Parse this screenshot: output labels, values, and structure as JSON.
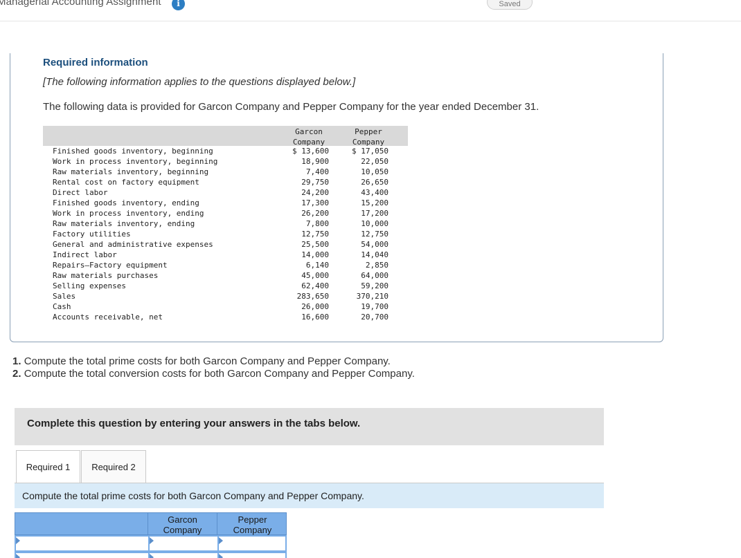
{
  "header": {
    "app_title": "Managerial Accounting Assignment",
    "info_icon": "info-icon",
    "saved_label": "Saved"
  },
  "required_info": {
    "heading": "Required information",
    "subheading": "[The following information applies to the questions displayed below.]",
    "intro": "The following data is provided for Garcon Company and Pepper Company for the year ended December 31."
  },
  "data_table": {
    "columns": [
      {
        "line1": "Garcon",
        "line2": "Company"
      },
      {
        "line1": "Pepper",
        "line2": "Company"
      }
    ],
    "rows": [
      {
        "label": "Finished goods inventory, beginning",
        "garcon": "$ 13,600",
        "pepper": "$ 17,050"
      },
      {
        "label": "Work in process inventory, beginning",
        "garcon": "18,900",
        "pepper": "22,050"
      },
      {
        "label": "Raw materials inventory, beginning",
        "garcon": "7,400",
        "pepper": "10,050"
      },
      {
        "label": "Rental cost on factory equipment",
        "garcon": "29,750",
        "pepper": "26,650"
      },
      {
        "label": "Direct labor",
        "garcon": "24,200",
        "pepper": "43,400"
      },
      {
        "label": "Finished goods inventory, ending",
        "garcon": "17,300",
        "pepper": "15,200"
      },
      {
        "label": "Work in process inventory, ending",
        "garcon": "26,200",
        "pepper": "17,200"
      },
      {
        "label": "Raw materials inventory, ending",
        "garcon": "7,800",
        "pepper": "10,000"
      },
      {
        "label": "Factory utilities",
        "garcon": "12,750",
        "pepper": "12,750"
      },
      {
        "label": "General and administrative expenses",
        "garcon": "25,500",
        "pepper": "54,000"
      },
      {
        "label": "Indirect labor",
        "garcon": "14,000",
        "pepper": "14,040"
      },
      {
        "label": "Repairs—Factory equipment",
        "garcon": "6,140",
        "pepper": "2,850"
      },
      {
        "label": "Raw materials purchases",
        "garcon": "45,000",
        "pepper": "64,000"
      },
      {
        "label": "Selling expenses",
        "garcon": "62,400",
        "pepper": "59,200"
      },
      {
        "label": "Sales",
        "garcon": "283,650",
        "pepper": "370,210"
      },
      {
        "label": "Cash",
        "garcon": "26,000",
        "pepper": "19,700"
      },
      {
        "label": "Accounts receivable, net",
        "garcon": "16,600",
        "pepper": "20,700"
      }
    ]
  },
  "questions": [
    {
      "num": "1.",
      "text": "Compute the total prime costs for both Garcon Company and Pepper Company."
    },
    {
      "num": "2.",
      "text": "Compute the total conversion costs for both Garcon Company and Pepper Company."
    }
  ],
  "complete_bar": {
    "text": "Complete this question by entering your answers in the tabs below."
  },
  "tabs": [
    {
      "label": "Required 1"
    },
    {
      "label": "Required 2"
    }
  ],
  "prompt": {
    "text": "Compute the total prime costs for both Garcon Company and Pepper Company."
  },
  "answer_grid": {
    "columns": [
      {
        "line1": "Garcon",
        "line2": "Company"
      },
      {
        "line1": "Pepper",
        "line2": "Company"
      }
    ]
  },
  "colors": {
    "heading": "#1c4f7d",
    "info_icon": "#2d7ec3",
    "grid_header": "#7aaee8",
    "prompt_bg": "#d9ebf8"
  }
}
